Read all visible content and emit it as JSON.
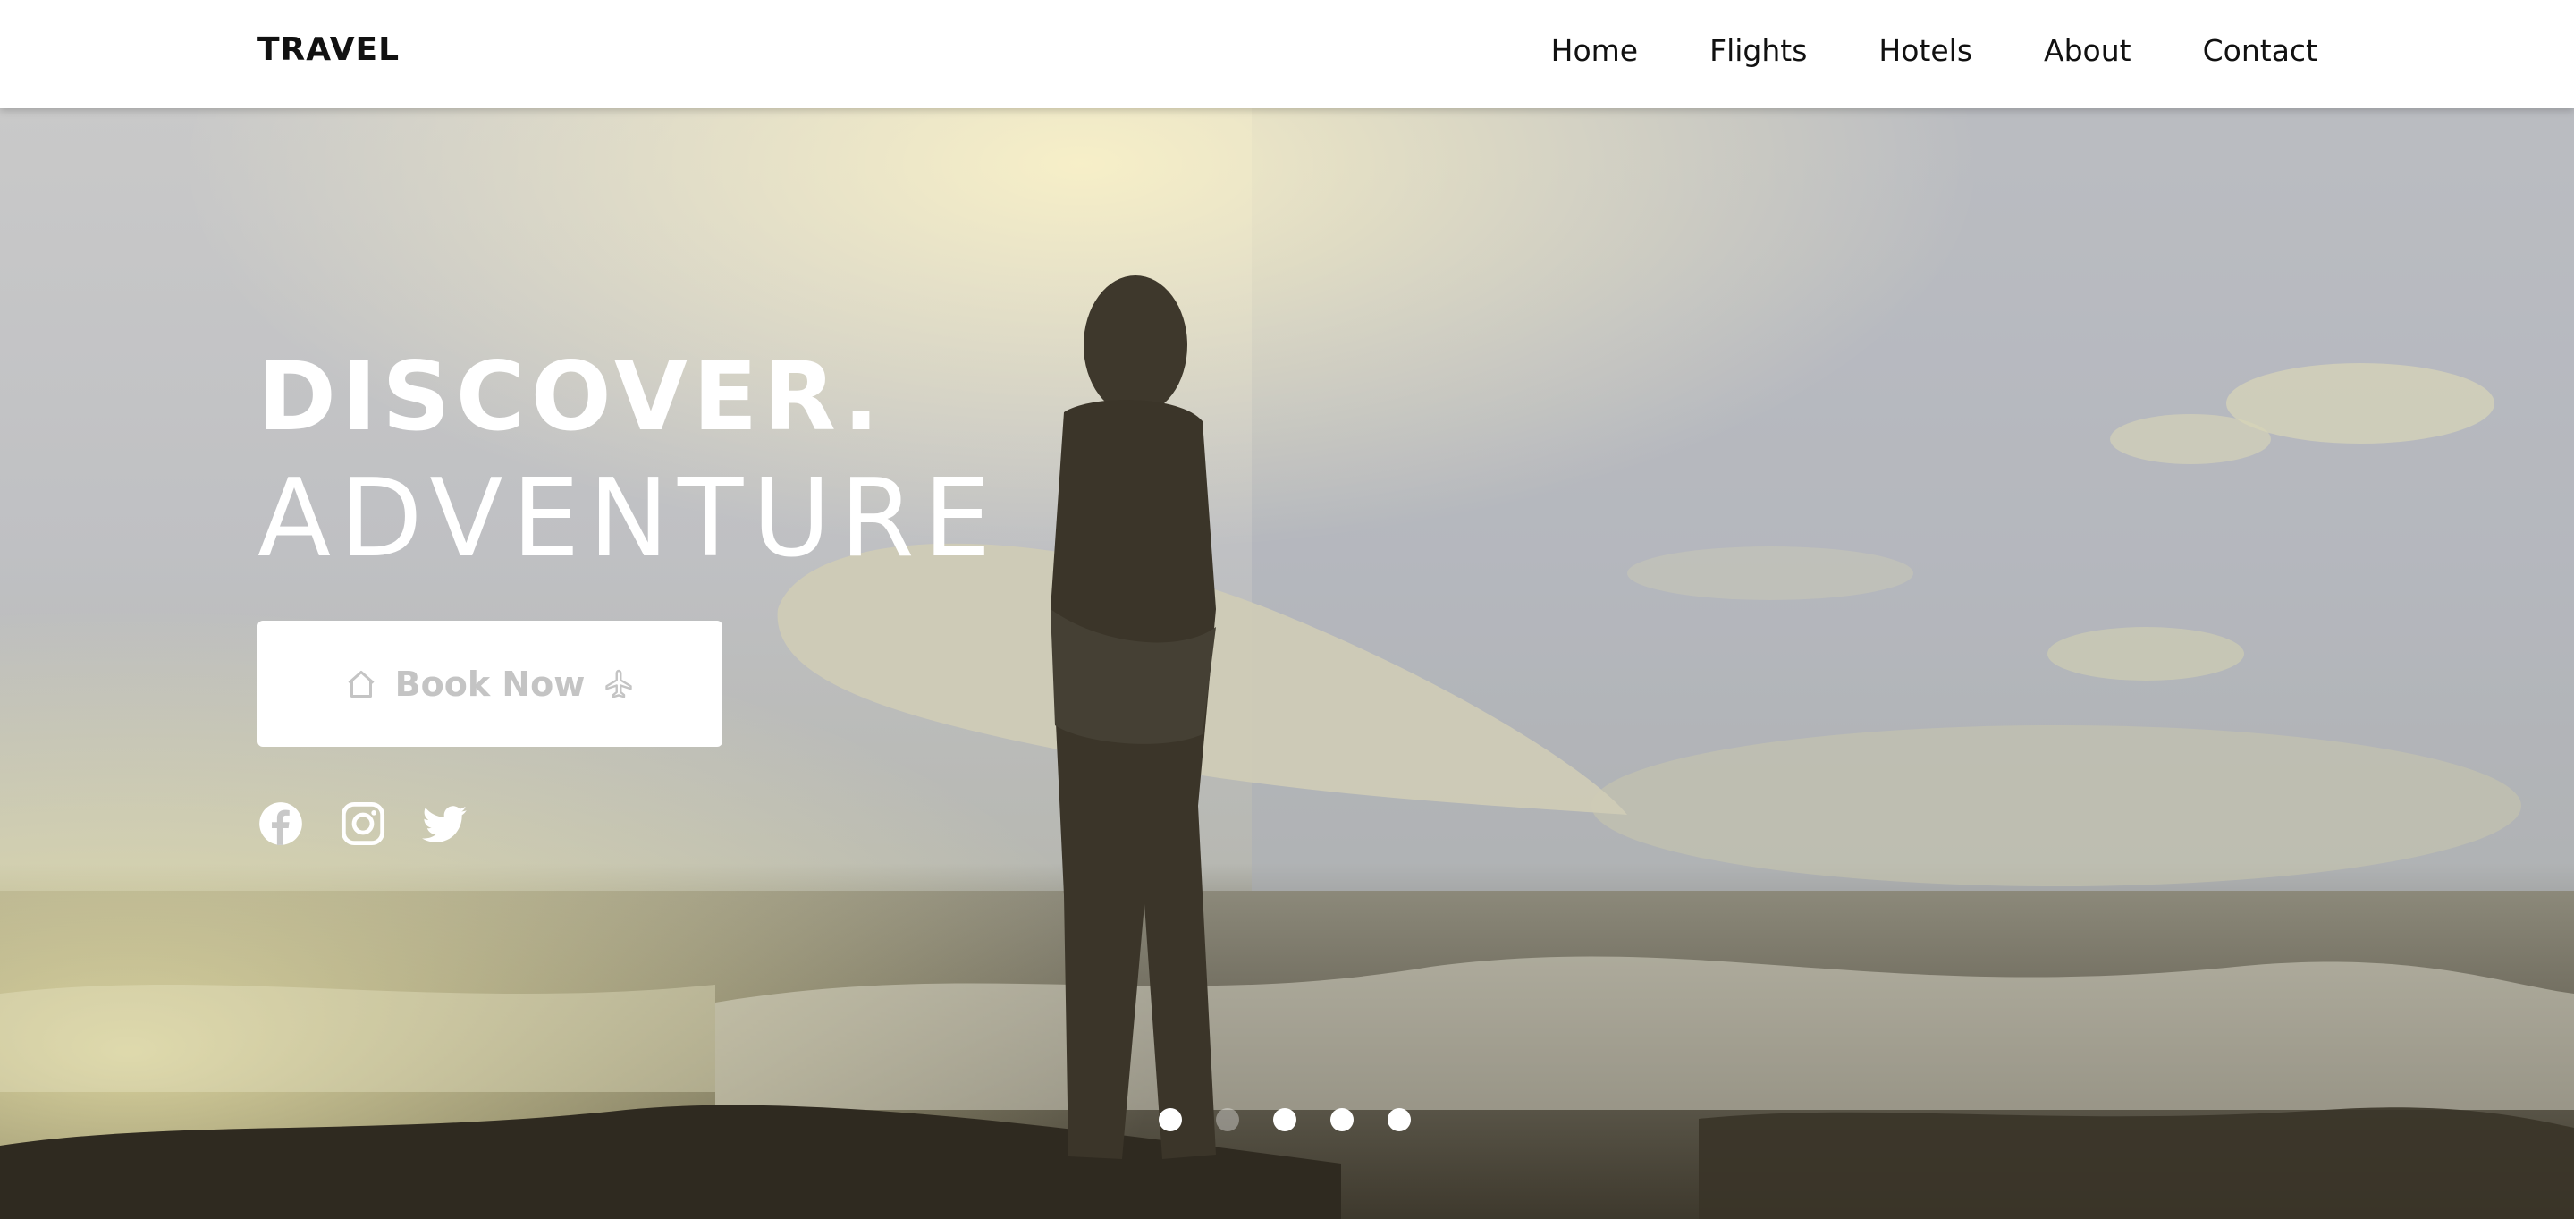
{
  "brand": {
    "logo": "TRAVEL"
  },
  "nav": {
    "items": [
      {
        "label": "Home"
      },
      {
        "label": "Flights"
      },
      {
        "label": "Hotels"
      },
      {
        "label": "About"
      },
      {
        "label": "Contact"
      }
    ]
  },
  "hero": {
    "line1": "DISCOVER.",
    "line2": "ADVENTURE",
    "cta": {
      "label": "Book Now",
      "left_icon": "home-icon",
      "right_icon": "airplane-icon"
    },
    "socials": [
      {
        "icon": "facebook-icon"
      },
      {
        "icon": "instagram-icon"
      },
      {
        "icon": "twitter-icon"
      }
    ],
    "slider": {
      "count": 5,
      "active_index": 1
    }
  },
  "colors": {
    "text_dark": "#111111",
    "hero_text": "#ffffff",
    "button_bg": "#ffffff",
    "button_text": "#c4c4c4"
  }
}
